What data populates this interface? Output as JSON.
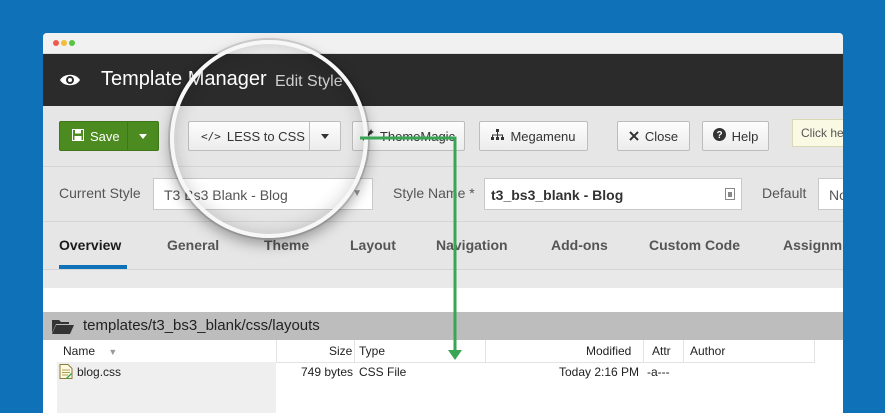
{
  "header": {
    "title": "Template Manager",
    "subtitle": "Edit Style"
  },
  "toolbar": {
    "save_label": "Save",
    "less_label": "LESS to CSS",
    "thememagic_label": "ThemeMagic",
    "megamenu_label": "Megamenu",
    "close_label": "Close",
    "help_label": "Help",
    "tip_text": "Click he"
  },
  "style_row": {
    "current_style_label": "Current Style",
    "current_style_value": "T3 Bs3 Blank - Blog",
    "style_name_label": "Style Name *",
    "style_name_value": "t3_bs3_blank - Blog",
    "default_label": "Default",
    "default_value": "No"
  },
  "tabs": [
    {
      "label": "Overview",
      "active": true
    },
    {
      "label": "General"
    },
    {
      "label": "Theme"
    },
    {
      "label": "Layout"
    },
    {
      "label": "Navigation"
    },
    {
      "label": "Add-ons"
    },
    {
      "label": "Custom Code"
    },
    {
      "label": "Assignm"
    }
  ],
  "file_browser": {
    "path": "templates/t3_bs3_blank/css/layouts",
    "columns": {
      "name": "Name",
      "size": "Size",
      "type": "Type",
      "modified": "Modified",
      "attr": "Attr",
      "author": "Author"
    },
    "files": [
      {
        "name": "blog.css",
        "size": "749 bytes",
        "type": "CSS File",
        "modified": "Today 2:16 PM",
        "attr": "-a---",
        "author": ""
      }
    ]
  },
  "colors": {
    "background": "#0f72b8",
    "save": "#4c8b1f",
    "header": "#2b2b2b",
    "arrow": "#3aa655",
    "tab_active": "#0f72b8"
  }
}
